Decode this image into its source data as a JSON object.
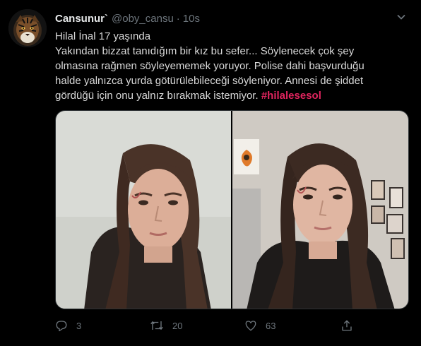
{
  "tweet": {
    "display_name": "Cansunur`",
    "handle": "@oby_cansu",
    "separator": "·",
    "time": "10s",
    "text_lines": [
      "Hilal İnal 17 yaşında",
      "Yakından bizzat tanıdığım bir kız bu sefer... Söylenecek çok şey",
      "olmasına rağmen söyleyememek yoruyor. Polise dahi başvurduğu",
      "halde yalnızca yurda götürülebileceği söyleniyor. Annesi de şiddet",
      "gördüğü için onu yalnız bırakmak istemiyor."
    ],
    "hashtag": "#hilalesesol",
    "stats": {
      "replies": "3",
      "retweets": "20",
      "likes": "63"
    }
  },
  "icons": {
    "avatar": "tiger-avatar",
    "more": "chevron-down-icon",
    "reply": "reply-icon",
    "retweet": "retweet-icon",
    "like": "heart-icon",
    "share": "share-icon"
  },
  "colors": {
    "background": "#000000",
    "text": "#d9d9d9",
    "muted": "#6e767d",
    "hashtag": "#e0245e"
  }
}
